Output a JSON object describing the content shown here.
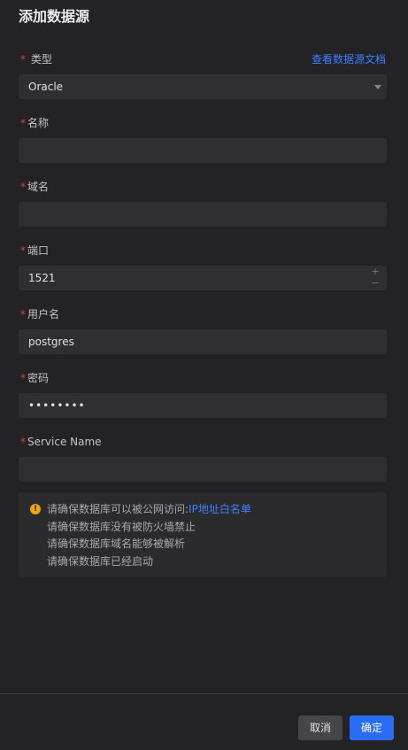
{
  "dialog": {
    "title": "添加数据源"
  },
  "fields": {
    "type": {
      "label": "类型",
      "required_mark": "*",
      "value": "Oracle",
      "doc_link": "查看数据源文档"
    },
    "name": {
      "label": "名称",
      "required_mark": "*",
      "value": ""
    },
    "domain": {
      "label": "域名",
      "required_mark": "*",
      "value": ""
    },
    "port": {
      "label": "端口",
      "required_mark": "*",
      "value": "1521",
      "increment": "+",
      "decrement": "−"
    },
    "username": {
      "label": "用户名",
      "required_mark": "*",
      "value": "postgres"
    },
    "password": {
      "label": "密码",
      "required_mark": "*",
      "value": "••••••••"
    },
    "service_name": {
      "label": "Service Name",
      "required_mark": "*",
      "value": ""
    }
  },
  "notice": {
    "icon": "warning-icon",
    "line1_text": "请确保数据库可以被公网访问:",
    "line1_link": "IP地址白名单",
    "line2": "请确保数据库没有被防火墙禁止",
    "line3": "请确保数据库域名能够被解析",
    "line4": "请确保数据库已经启动"
  },
  "footer": {
    "cancel_label": "取消",
    "ok_label": "确定"
  },
  "colors": {
    "background": "#232325",
    "input_bg": "#2f2f31",
    "accent": "#2a6df4",
    "link": "#3d7fff",
    "required": "#e53e3e",
    "warning": "#f2a20c"
  }
}
